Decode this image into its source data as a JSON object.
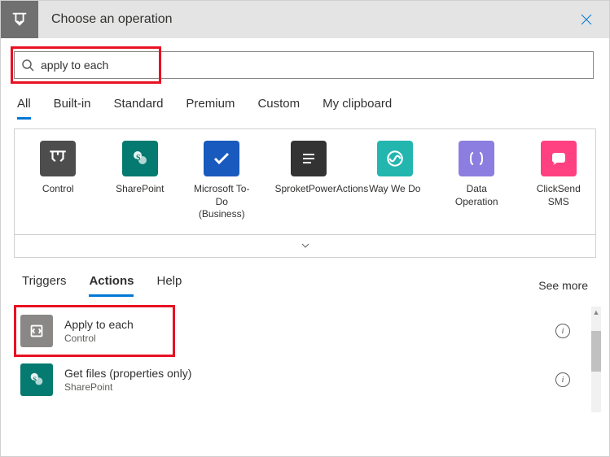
{
  "header": {
    "title": "Choose an operation"
  },
  "search": {
    "value": "apply to each"
  },
  "tabs": [
    "All",
    "Built-in",
    "Standard",
    "Premium",
    "Custom",
    "My clipboard"
  ],
  "active_tab": 0,
  "connectors": [
    {
      "label": "Control",
      "bg": "#4d4d4d",
      "icon": "control"
    },
    {
      "label": "SharePoint",
      "bg": "#047a70",
      "icon": "sharepoint"
    },
    {
      "label": "Microsoft To-Do (Business)",
      "bg": "#185abd",
      "icon": "todo"
    },
    {
      "label": "SproketPowerActions",
      "bg": "#333333",
      "icon": "sproket"
    },
    {
      "label": "Way We Do",
      "bg": "#22b6af",
      "icon": "wwd"
    },
    {
      "label": "Data Operation",
      "bg": "#8c7ee0",
      "icon": "data"
    },
    {
      "label": "ClickSend SMS",
      "bg": "#ff4081",
      "icon": "sms"
    }
  ],
  "subtabs": [
    "Triggers",
    "Actions",
    "Help"
  ],
  "active_subtab": 1,
  "see_more": "See more",
  "results": [
    {
      "title": "Apply to each",
      "sub": "Control",
      "bg": "#8a8886",
      "icon": "loop"
    },
    {
      "title": "Get files (properties only)",
      "sub": "SharePoint",
      "bg": "#047a70",
      "icon": "sharepoint"
    }
  ]
}
